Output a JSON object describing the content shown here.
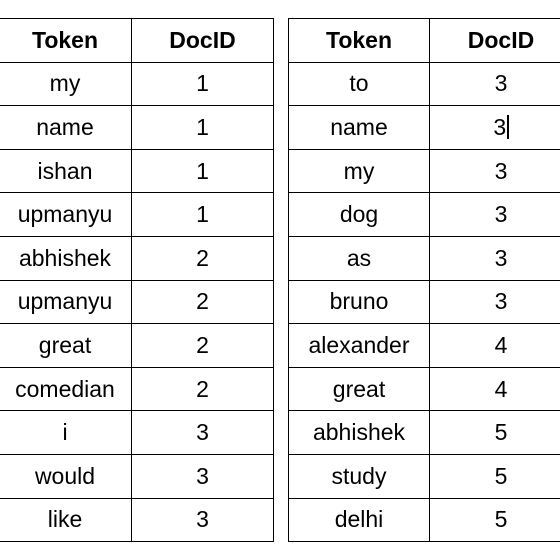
{
  "tables": [
    {
      "headers": [
        "Token",
        "DocID"
      ],
      "rows": [
        [
          "my",
          "1"
        ],
        [
          "name",
          "1"
        ],
        [
          "ishan",
          "1"
        ],
        [
          "upmanyu",
          "1"
        ],
        [
          "abhishek",
          "2"
        ],
        [
          "upmanyu",
          "2"
        ],
        [
          "great",
          "2"
        ],
        [
          "comedian",
          "2"
        ],
        [
          "i",
          "3"
        ],
        [
          "would",
          "3"
        ],
        [
          "like",
          "3"
        ]
      ]
    },
    {
      "headers": [
        "Token",
        "DocID"
      ],
      "rows": [
        [
          "to",
          "3"
        ],
        [
          "name",
          "3"
        ],
        [
          "my",
          "3"
        ],
        [
          "dog",
          "3"
        ],
        [
          "as",
          "3"
        ],
        [
          "bruno",
          "3"
        ],
        [
          "alexander",
          "4"
        ],
        [
          "great",
          "4"
        ],
        [
          "abhishek",
          "5"
        ],
        [
          "study",
          "5"
        ],
        [
          "delhi",
          "5"
        ]
      ]
    }
  ]
}
